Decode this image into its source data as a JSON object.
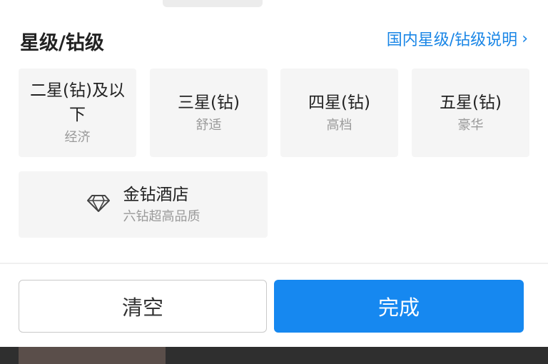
{
  "header": {
    "title": "星级/钻级",
    "info_link": "国内星级/钻级说明"
  },
  "tiles": [
    {
      "main": "二星(钻)及以下",
      "sub": "经济"
    },
    {
      "main": "三星(钻)",
      "sub": "舒适"
    },
    {
      "main": "四星(钻)",
      "sub": "高档"
    },
    {
      "main": "五星(钻)",
      "sub": "豪华"
    },
    {
      "main": "金钻酒店",
      "sub": "六钻超高品质",
      "icon": "diamond-icon"
    }
  ],
  "buttons": {
    "clear": "清空",
    "done": "完成"
  },
  "colors": {
    "accent": "#1688f0",
    "link": "#1a86e6",
    "tile_bg": "#f5f5f5"
  }
}
